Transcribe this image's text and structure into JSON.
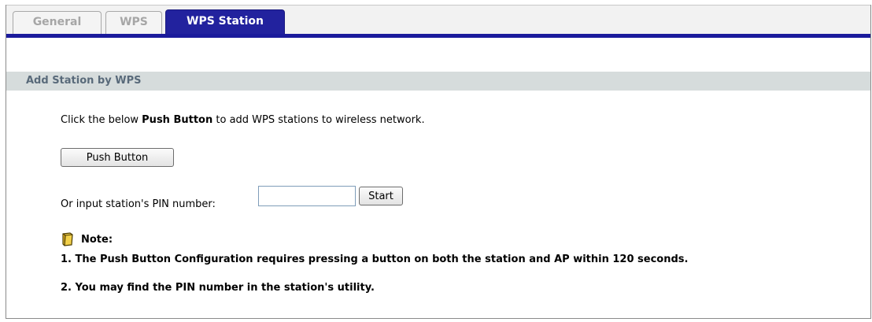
{
  "tabs": [
    {
      "label": "General"
    },
    {
      "label": "WPS"
    },
    {
      "label": "WPS Station"
    }
  ],
  "section": {
    "title": "Add Station by WPS"
  },
  "instructions": {
    "prefix": "Click the below ",
    "bold": "Push Button",
    "suffix": " to add WPS stations to wireless network."
  },
  "push_button_label": "Push Button",
  "pin": {
    "label": "Or input station's PIN number:",
    "value": "",
    "start_label": "Start"
  },
  "note": {
    "title": "Note:",
    "lines": [
      "1. The Push Button Configuration requires pressing a button on both the station and AP within 120 seconds.",
      "2. You may find the PIN number in the station's utility."
    ]
  },
  "colors": {
    "tab_active": "#22229e",
    "section_bg": "#d6dcdc",
    "section_text": "#596a7a"
  }
}
